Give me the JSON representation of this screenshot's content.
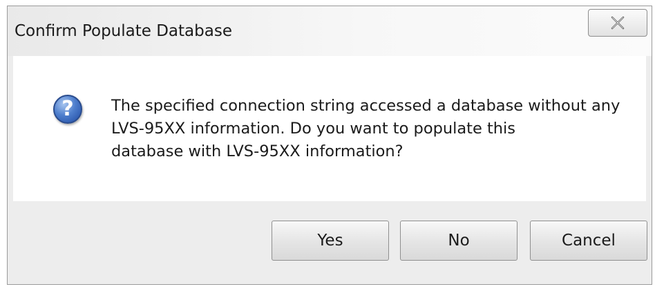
{
  "window": {
    "title": "Confirm Populate Database",
    "close_icon": "close-icon"
  },
  "dialog": {
    "icon": "question-icon",
    "icon_glyph": "?",
    "message_lines": [
      "The specified connection string accessed a database without any",
      "LVS-95XX information.  Do you want to populate this",
      "database with LVS-95XX information?"
    ]
  },
  "buttons": {
    "yes_label": "Yes",
    "no_label": "No",
    "cancel_label": "Cancel"
  },
  "colors": {
    "icon_blue": "#3f6fc2",
    "dialog_background": "#ededed",
    "content_background": "#ffffff"
  }
}
